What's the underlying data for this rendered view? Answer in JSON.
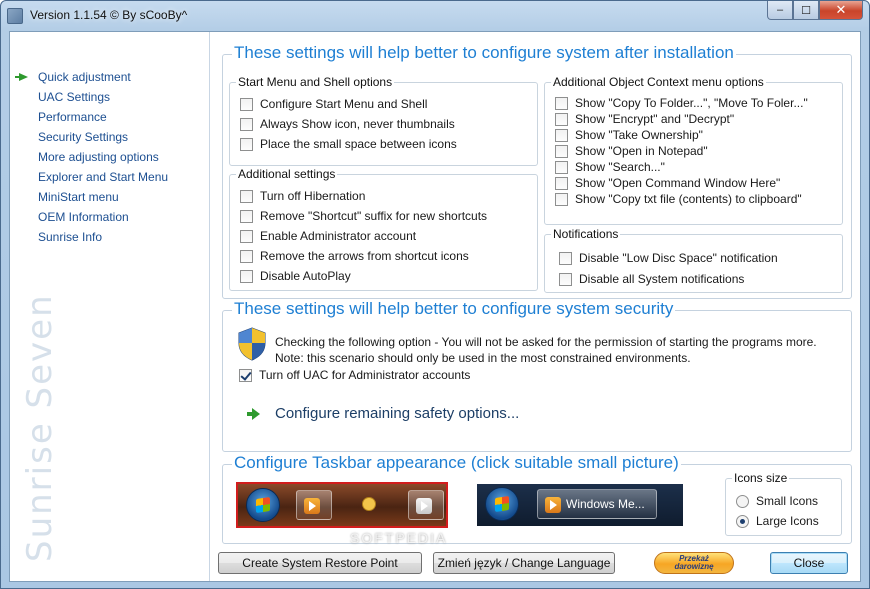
{
  "window": {
    "title": "Version 1.1.54 © By sCooBy^",
    "caption": {
      "minimize": "‒",
      "maximize": "☐",
      "close": "✕"
    }
  },
  "sidebar": {
    "items": [
      {
        "label": "Quick adjustment",
        "active": true
      },
      {
        "label": "UAC Settings"
      },
      {
        "label": "Performance"
      },
      {
        "label": "Security Settings"
      },
      {
        "label": "More adjusting options"
      },
      {
        "label": "Explorer and Start Menu"
      },
      {
        "label": "MiniStart menu"
      },
      {
        "label": "OEM Information"
      },
      {
        "label": "Sunrise Info"
      }
    ],
    "brand_text": "Sunrise Seven"
  },
  "install_section": {
    "title": "These settings will help better to configure system after installation",
    "start_menu_group": {
      "title": "Start Menu and Shell options",
      "options": [
        {
          "label": "Configure Start Menu and Shell",
          "checked": false
        },
        {
          "label": "Always Show icon, never thumbnails",
          "checked": false
        },
        {
          "label": "Place the small space between icons",
          "checked": false
        }
      ]
    },
    "additional_group": {
      "title": "Additional settings",
      "options": [
        {
          "label": "Turn off Hibernation",
          "checked": false
        },
        {
          "label": "Remove \"Shortcut\" suffix for new shortcuts",
          "checked": false
        },
        {
          "label": "Enable Administrator account",
          "checked": false
        },
        {
          "label": "Remove the arrows from shortcut icons",
          "checked": false
        },
        {
          "label": "Disable AutoPlay",
          "checked": false
        }
      ]
    },
    "context_group": {
      "title": "Additional Object Context menu options",
      "options": [
        {
          "label": "Show \"Copy To Folder...\", \"Move To Foler...\"",
          "checked": false
        },
        {
          "label": "Show \"Encrypt\" and \"Decrypt\"",
          "checked": false
        },
        {
          "label": "Show \"Take Ownership\"",
          "checked": false
        },
        {
          "label": "Show \"Open in Notepad\"",
          "checked": false
        },
        {
          "label": "Show \"Search...\"",
          "checked": false
        },
        {
          "label": "Show \"Open Command Window Here\"",
          "checked": false
        },
        {
          "label": "Show \"Copy txt file (contents) to clipboard\"",
          "checked": false
        }
      ]
    },
    "notifications_group": {
      "title": "Notifications",
      "options": [
        {
          "label": "Disable \"Low Disc Space\" notification",
          "checked": false
        },
        {
          "label": "Disable all System notifications",
          "checked": false
        }
      ]
    }
  },
  "security_section": {
    "title": "These settings will help better to configure system security",
    "info_line1": "Checking the following option - You will not be asked for the permission of starting the programs more.",
    "info_line2": "Note: this scenario should only be used in the most constrained environments.",
    "uac_option": {
      "label": "Turn off UAC for Administrator accounts",
      "checked": true
    },
    "link_label": "Configure remaining safety options..."
  },
  "taskbar_section": {
    "title": "Configure Taskbar appearance (click suitable small picture)",
    "preview_large_label": "Windows Me...",
    "icons_size": {
      "title": "Icons size",
      "options": [
        {
          "label": "Small Icons",
          "checked": false
        },
        {
          "label": "Large Icons",
          "checked": true
        }
      ]
    }
  },
  "footer": {
    "restore_point": "Create System Restore Point",
    "change_language": "Zmień język / Change Language",
    "donate_line1": "Przekaż",
    "donate_line2": "darowiznę",
    "close": "Close"
  },
  "watermark": "SOFTPEDIA"
}
